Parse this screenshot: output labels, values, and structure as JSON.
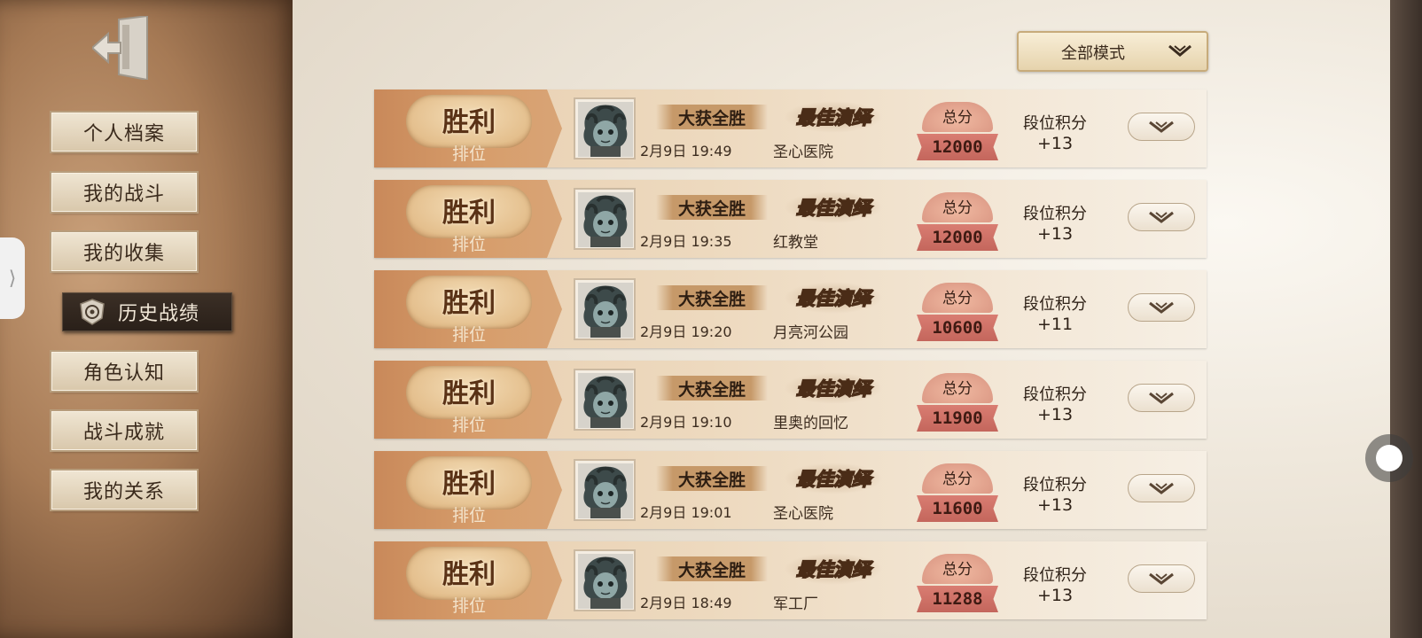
{
  "sidebar": {
    "exit_icon": "exit-door-icon",
    "items": [
      {
        "label": "个人档案",
        "active": false
      },
      {
        "label": "我的战斗",
        "active": false
      },
      {
        "label": "我的收集",
        "active": false
      },
      {
        "label": "历史战绩",
        "active": true
      },
      {
        "label": "角色认知",
        "active": false
      },
      {
        "label": "战斗成就",
        "active": false
      },
      {
        "label": "我的关系",
        "active": false
      }
    ]
  },
  "filter": {
    "mode_label": "全部模式"
  },
  "labels": {
    "score_caption": "总分",
    "rank_caption": "段位积分"
  },
  "records": [
    {
      "result": "胜利",
      "type": "排位",
      "tag": "大获全胜",
      "badge": "最佳演绎",
      "date": "2月9日 19:49",
      "map": "圣心医院",
      "score": "12000",
      "rank_delta": "+13"
    },
    {
      "result": "胜利",
      "type": "排位",
      "tag": "大获全胜",
      "badge": "最佳演绎",
      "date": "2月9日 19:35",
      "map": "红教堂",
      "score": "12000",
      "rank_delta": "+13"
    },
    {
      "result": "胜利",
      "type": "排位",
      "tag": "大获全胜",
      "badge": "最佳演绎",
      "date": "2月9日 19:20",
      "map": "月亮河公园",
      "score": "10600",
      "rank_delta": "+11"
    },
    {
      "result": "胜利",
      "type": "排位",
      "tag": "大获全胜",
      "badge": "最佳演绎",
      "date": "2月9日 19:10",
      "map": "里奥的回忆",
      "score": "11900",
      "rank_delta": "+13"
    },
    {
      "result": "胜利",
      "type": "排位",
      "tag": "大获全胜",
      "badge": "最佳演绎",
      "date": "2月9日 19:01",
      "map": "圣心医院",
      "score": "11600",
      "rank_delta": "+13"
    },
    {
      "result": "胜利",
      "type": "排位",
      "tag": "大获全胜",
      "badge": "最佳演绎",
      "date": "2月9日 18:49",
      "map": "军工厂",
      "score": "11288",
      "rank_delta": "+13"
    }
  ]
}
